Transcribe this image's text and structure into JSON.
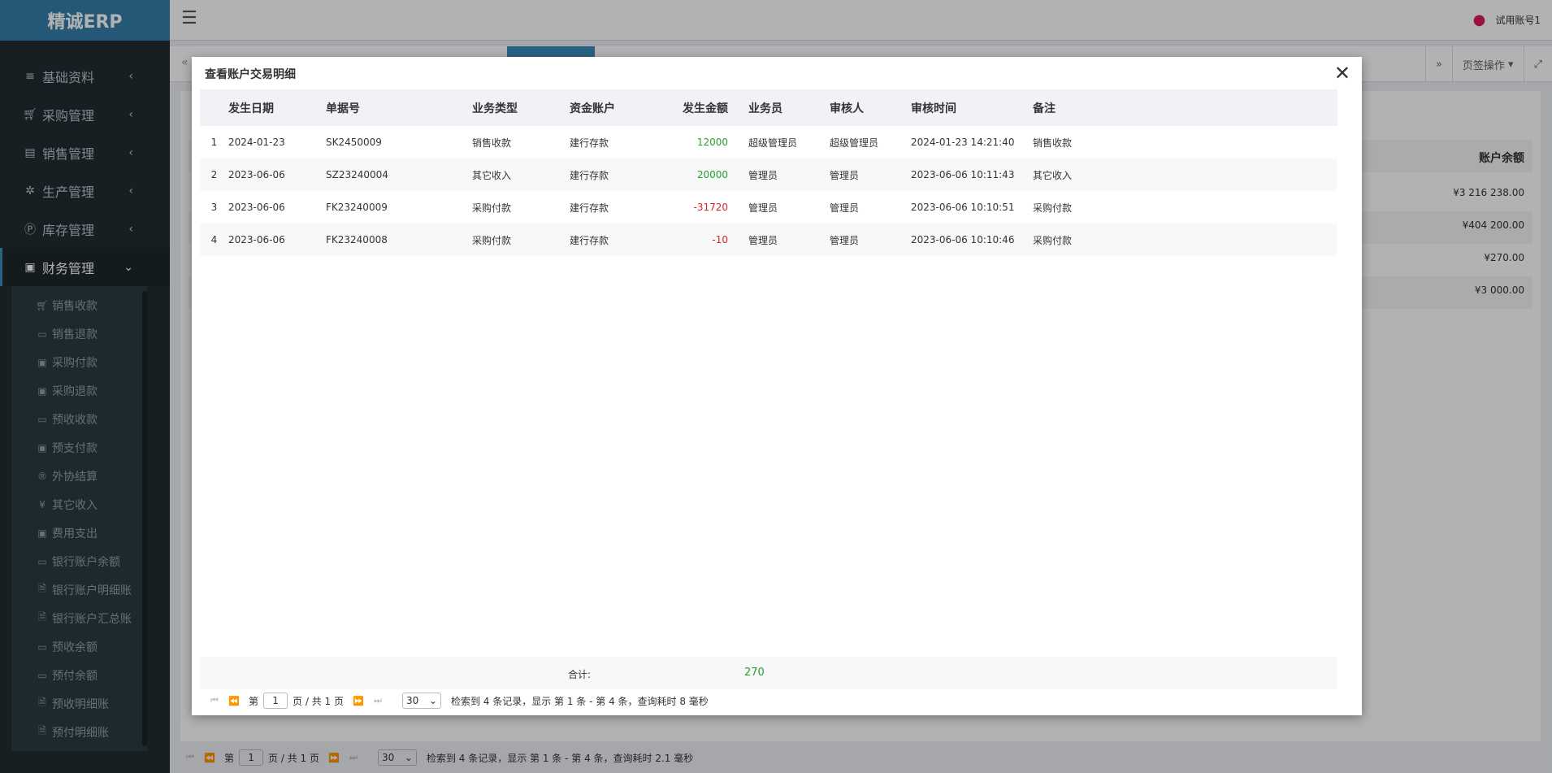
{
  "brand": "精诚ERP",
  "topbar": {
    "user": "试用账号1"
  },
  "sidebar": {
    "items": [
      {
        "label": "基础资料",
        "icon": "list-icon"
      },
      {
        "label": "采购管理",
        "icon": "cart-icon"
      },
      {
        "label": "销售管理",
        "icon": "document-icon"
      },
      {
        "label": "生产管理",
        "icon": "gears-icon"
      },
      {
        "label": "库存管理",
        "icon": "p-circle-icon"
      },
      {
        "label": "财务管理",
        "icon": "money-icon"
      }
    ],
    "finance_items": [
      "销售收款",
      "销售退款",
      "采购付款",
      "采购退款",
      "预收收款",
      "预支付款",
      "外协结算",
      "其它收入",
      "费用支出",
      "银行账户余额",
      "银行账户明细账",
      "银行账户汇总账",
      "预收余额",
      "预付余额",
      "预收明细账",
      "预付明细账"
    ]
  },
  "tabbar": {
    "page_ops": "页签操作"
  },
  "background": {
    "balance_header": "账户余额",
    "balances": [
      "¥3 216 238.00",
      "¥404 200.00",
      "¥270.00",
      "¥3 000.00"
    ],
    "pager": {
      "page_prefix": "第",
      "page_value": "1",
      "page_suffix": "页 / 共 1 页",
      "page_size": "30",
      "summary": "检索到 4 条记录，显示 第 1 条 - 第 4 条，查询耗时 2.1 毫秒"
    }
  },
  "modal": {
    "title": "查看账户交易明细",
    "columns": [
      "发生日期",
      "单据号",
      "业务类型",
      "资金账户",
      "发生金额",
      "业务员",
      "审核人",
      "审核时间",
      "备注"
    ],
    "rows": [
      {
        "no": "1",
        "date": "2024-01-23",
        "doc": "SK2450009",
        "type": "销售收款",
        "account": "建行存款",
        "amount": "12000",
        "sales": "超级管理员",
        "auditor": "超级管理员",
        "audit_time": "2024-01-23 14:21:40",
        "remark": "销售收款"
      },
      {
        "no": "2",
        "date": "2023-06-06",
        "doc": "SZ23240004",
        "type": "其它收入",
        "account": "建行存款",
        "amount": "20000",
        "sales": "管理员",
        "auditor": "管理员",
        "audit_time": "2023-06-06 10:11:43",
        "remark": "其它收入"
      },
      {
        "no": "3",
        "date": "2023-06-06",
        "doc": "FK23240009",
        "type": "采购付款",
        "account": "建行存款",
        "amount": "-31720",
        "sales": "管理员",
        "auditor": "管理员",
        "audit_time": "2023-06-06 10:10:51",
        "remark": "采购付款"
      },
      {
        "no": "4",
        "date": "2023-06-06",
        "doc": "FK23240008",
        "type": "采购付款",
        "account": "建行存款",
        "amount": "-10",
        "sales": "管理员",
        "auditor": "管理员",
        "audit_time": "2023-06-06 10:10:46",
        "remark": "采购付款"
      }
    ],
    "total_label": "合计:",
    "total_value": "270",
    "pager": {
      "page_prefix": "第",
      "page_value": "1",
      "page_suffix": "页 / 共 1 页",
      "page_size": "30",
      "summary": "检索到 4 条记录，显示 第 1 条 - 第 4 条，查询耗时 8 毫秒"
    }
  },
  "colors": {
    "sidebar_bg": "#222d32",
    "brand_bg": "#367fa9",
    "positive": "#2a9d2a",
    "negative": "#d9232a"
  }
}
